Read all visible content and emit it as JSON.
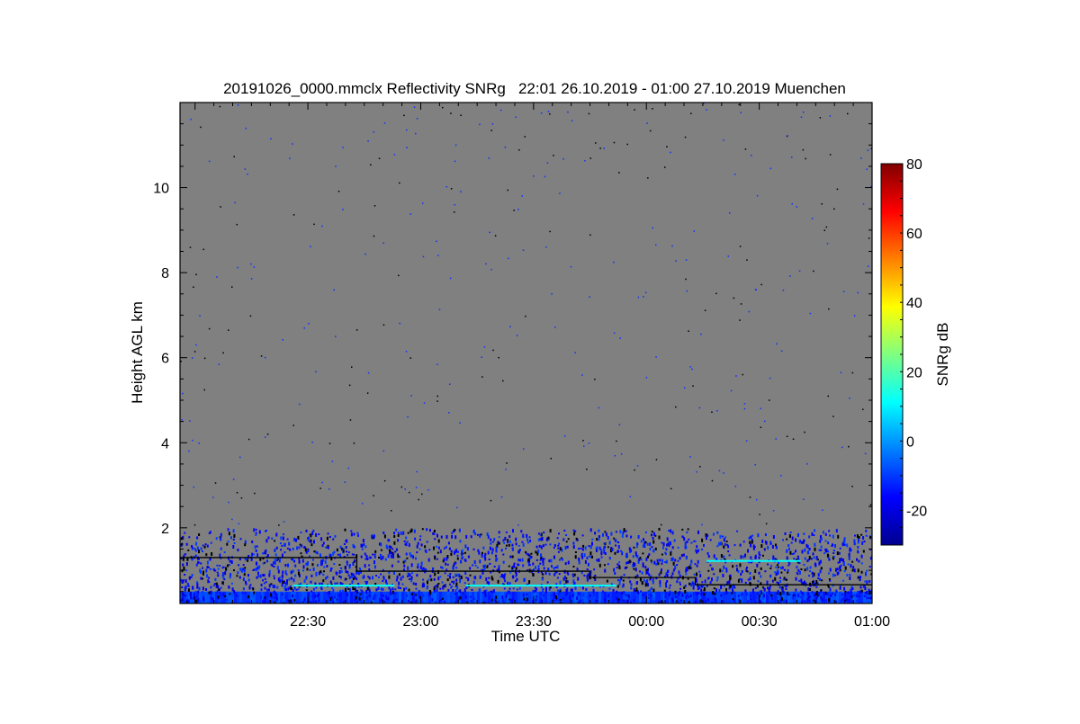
{
  "chart_data": {
    "type": "heatmap",
    "title": "20191026_0000.mmclx Reflectivity SNRg   22:01 26.10.2019 - 01:00 27.10.2019 Muenchen",
    "xlabel": "Time UTC",
    "ylabel": "Height AGL km",
    "xlim": [
      "21:56",
      "01:00"
    ],
    "ylim": [
      0.22,
      12.0
    ],
    "x_ticks": [
      "22:30",
      "23:00",
      "23:30",
      "00:00",
      "00:30",
      "01:00"
    ],
    "y_ticks": [
      2,
      4,
      6,
      8,
      10
    ],
    "background_color": "#808080",
    "colorbar": {
      "label": "SNRg dB",
      "range": [
        -30,
        80
      ],
      "ticks": [
        -20,
        0,
        20,
        40,
        60,
        80
      ],
      "colormap": "jet"
    },
    "lines": [
      {
        "color": "#000000",
        "steps": [
          {
            "start": "21:56",
            "end": "22:43",
            "height_km": 1.3
          },
          {
            "start": "22:43",
            "end": "23:45",
            "height_km": 0.98
          },
          {
            "start": "23:45",
            "end": "00:13",
            "height_km": 0.83
          },
          {
            "start": "00:13",
            "end": "01:00",
            "height_km": 0.66
          }
        ]
      }
    ],
    "features": [
      {
        "color": "#00ffff",
        "start": "22:26",
        "end": "22:53",
        "height_km": 0.64,
        "snr_db": 10
      },
      {
        "color": "#00ffff",
        "start": "23:12",
        "end": "23:52",
        "height_km": 0.64,
        "snr_db": 10
      },
      {
        "color": "#00ffff",
        "start": "00:16",
        "end": "00:41",
        "height_km": 1.22,
        "snr_db": 10
      }
    ],
    "signal_layer": {
      "top_km": 2.0,
      "typical_snr_db": -15,
      "near_surface_snr_db": -10
    }
  }
}
